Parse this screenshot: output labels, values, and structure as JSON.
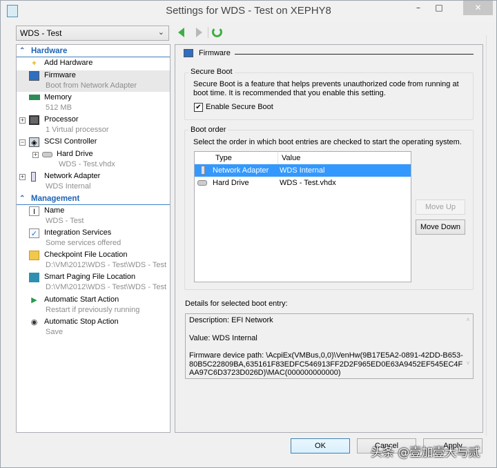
{
  "window": {
    "title": "Settings for WDS - Test on XEPHY8",
    "minimize": "–",
    "maximize": "□",
    "close": "✕"
  },
  "vm_selector": {
    "value": "WDS - Test"
  },
  "nav": {
    "back": "back-arrow",
    "forward": "forward-arrow",
    "refresh": "refresh"
  },
  "tree": {
    "hardware_header": "Hardware",
    "management_header": "Management",
    "hardware": [
      {
        "label": "Add Hardware",
        "sub": ""
      },
      {
        "label": "Firmware",
        "sub": "Boot from Network Adapter",
        "selected": true
      },
      {
        "label": "Memory",
        "sub": "512 MB"
      },
      {
        "label": "Processor",
        "sub": "1 Virtual processor",
        "expander": "+"
      },
      {
        "label": "SCSI Controller",
        "sub": "",
        "expander": "−"
      },
      {
        "label": "Hard Drive",
        "sub": "WDS - Test.vhdx",
        "expander": "+"
      },
      {
        "label": "Network Adapter",
        "sub": "WDS Internal",
        "expander": "+"
      }
    ],
    "management": [
      {
        "label": "Name",
        "sub": "WDS - Test"
      },
      {
        "label": "Integration Services",
        "sub": "Some services offered"
      },
      {
        "label": "Checkpoint File Location",
        "sub": "D:\\VM\\2012\\WDS - Test\\WDS - Test"
      },
      {
        "label": "Smart Paging File Location",
        "sub": "D:\\VM\\2012\\WDS - Test\\WDS - Test"
      },
      {
        "label": "Automatic Start Action",
        "sub": "Restart if previously running"
      },
      {
        "label": "Automatic Stop Action",
        "sub": "Save"
      }
    ]
  },
  "firmware": {
    "section_title": "Firmware",
    "secure_boot": {
      "title": "Secure Boot",
      "description": "Secure Boot is a feature that helps prevents unauthorized code from running at boot time. It is recommended that you enable this setting.",
      "checkbox_label": "Enable Secure Boot",
      "checked": true
    },
    "boot_order": {
      "title": "Boot order",
      "instruction": "Select the order in which boot entries are checked to start the operating system.",
      "columns": [
        "Type",
        "Value"
      ],
      "rows": [
        {
          "type": "Network Adapter",
          "value": "WDS Internal",
          "selected": true
        },
        {
          "type": "Hard Drive",
          "value": "WDS - Test.vhdx"
        }
      ],
      "move_up": "Move Up",
      "move_down": "Move Down"
    },
    "details": {
      "label": "Details for selected boot entry:",
      "description": "Description: EFI Network",
      "value": "Value: WDS Internal",
      "path": "Firmware device path: \\AcpiEx(VMBus,0,0)\\VenHw(9B17E5A2-0891-42DD-B653-80B5C22809BA,635161F83EDFC546913FF2D2F965ED0E63A9452EF545EC4FAA97C6D3723D026D)\\MAC(000000000000)"
    }
  },
  "footer": {
    "ok": "OK",
    "cancel": "Cancel",
    "apply": "Apply"
  },
  "watermark": "头条 @壹加壹大与贰",
  "colors": {
    "accent": "#1e63b5",
    "selection": "#3399ff"
  }
}
